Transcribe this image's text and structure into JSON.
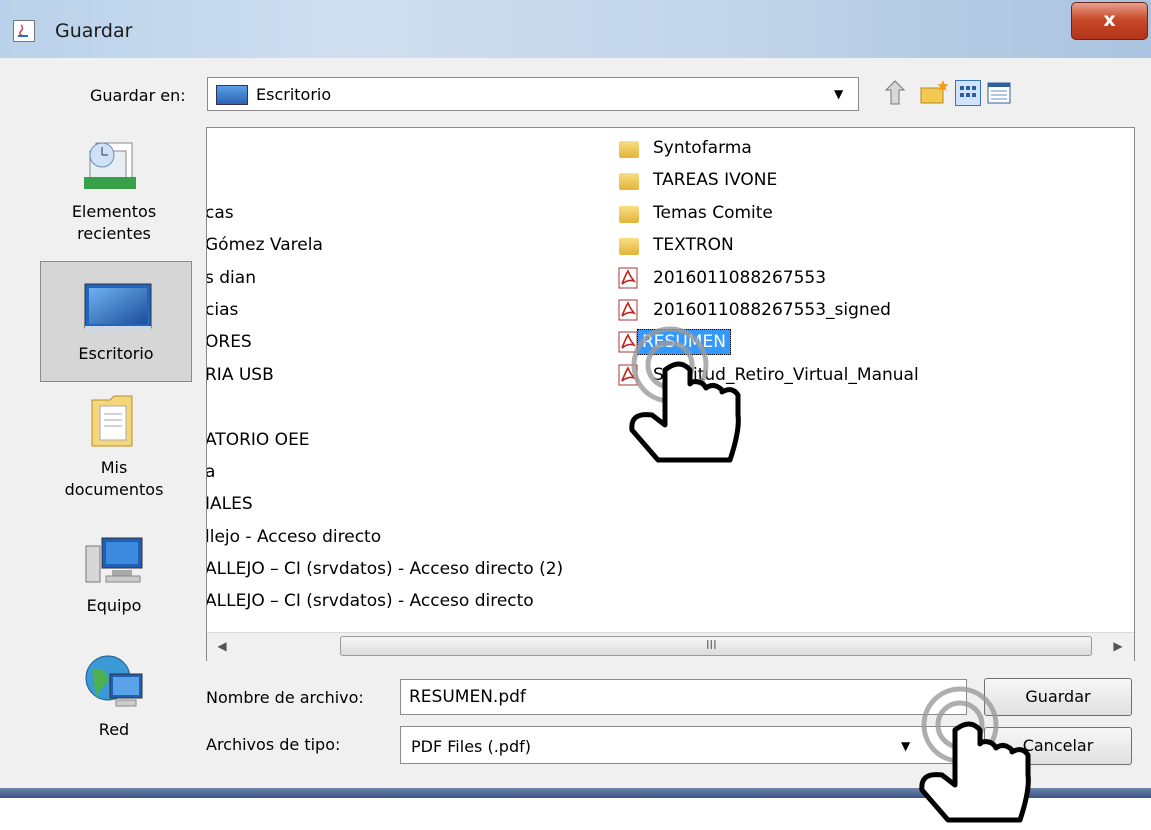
{
  "window": {
    "title": "Guardar",
    "close_label": "x"
  },
  "toolbar": {
    "save_in_label": "Guardar en:",
    "location": "Escritorio"
  },
  "places": [
    {
      "label_lines": [
        "Elementos",
        "recientes"
      ]
    },
    {
      "label_lines": [
        "Escritorio"
      ]
    },
    {
      "label_lines": [
        "Mis",
        "documentos"
      ]
    },
    {
      "label_lines": [
        "Equipo"
      ]
    },
    {
      "label_lines": [
        "Red"
      ]
    }
  ],
  "files_left": [
    "cas",
    "Gómez Varela",
    "s dian",
    "cias",
    "ORES",
    "RIA USB",
    "ATORIO OEE",
    "a",
    "IALES",
    "llejo - Acceso directo",
    "ALLEJO – CI (srvdatos) - Acceso directo (2)",
    "ALLEJO – CI (srvdatos) - Acceso directo"
  ],
  "files_right": [
    {
      "name": "Syntofarma",
      "icon": "folder-icon"
    },
    {
      "name": "TAREAS IVONE",
      "icon": "folder-icon"
    },
    {
      "name": "Temas Comite",
      "icon": "folder-icon"
    },
    {
      "name": "TEXTRON",
      "icon": "folder-icon"
    },
    {
      "name": "2016011088267553",
      "icon": "pdf-icon"
    },
    {
      "name": "2016011088267553_signed",
      "icon": "pdf-icon"
    },
    {
      "name": "RESUMEN",
      "icon": "pdf-icon",
      "selected": true
    },
    {
      "name": "Solicitud_Retiro_Virtual_Manual",
      "icon": "pdf-icon"
    }
  ],
  "scrollbar": {
    "grip": "III"
  },
  "form": {
    "filename_label": "Nombre de archivo:",
    "filename_value": "RESUMEN.pdf",
    "filetype_label": "Archivos de tipo:",
    "filetype_value": "PDF Files (.pdf)",
    "save_button": "Guardar",
    "cancel_button": "Cancelar"
  }
}
